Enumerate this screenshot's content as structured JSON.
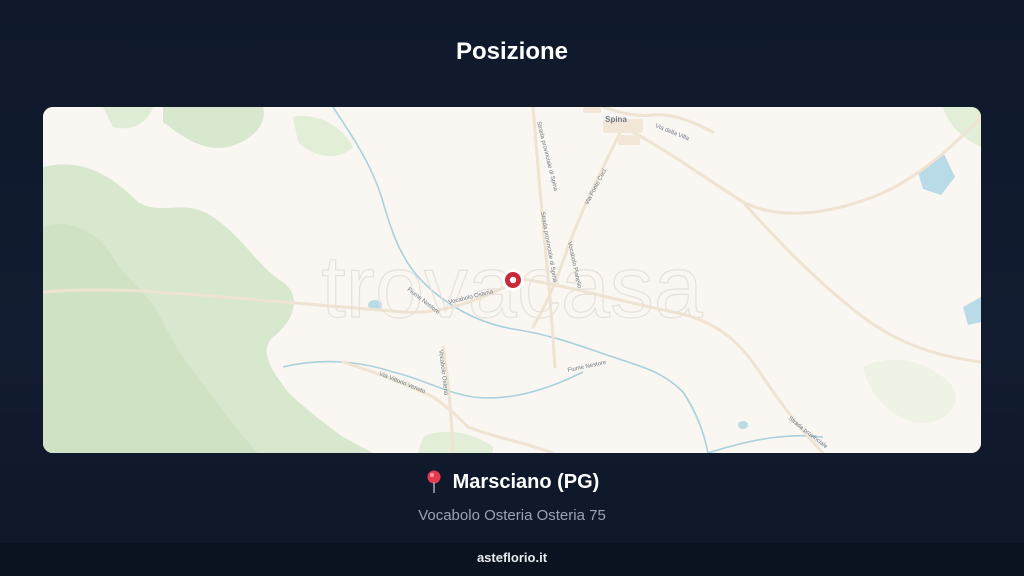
{
  "header": {
    "title": "Posizione"
  },
  "map": {
    "watermark": "trovacasa",
    "labels": {
      "spina": "Spina",
      "via_della_villa": "Via della Villa",
      "strada_provinciale_1": "Strada provinciale di Spina",
      "strada_provinciale_2": "Strada provinciale di Spina",
      "via_fonte_ceci": "Via Fonte Ceci",
      "vocabolo_osteria_1": "Vocabolo Osteria",
      "vocabolo_osteria_2": "Vocabolo Osteria",
      "vocabolo_pianello": "Vocabolo Pianello",
      "fiume_nestore_1": "Fiume Nestore",
      "fiume_nestore_2": "Fiume Nestore",
      "via_vittorio_veneto": "Via Vittorio Veneto",
      "strada_provinciale_3": "Strada provinciale"
    },
    "marker_icon": "location-marker-icon",
    "colors": {
      "land": "#faf6f1",
      "forest": "#d8e8cf",
      "forest_dark": "#cfe3c4",
      "water": "#b9dbe7",
      "river": "#9fcbd9",
      "road": "#f0e6d8",
      "marker": "#c8283a"
    }
  },
  "location": {
    "pin_icon": "red-pushpin-icon",
    "city": "Marsciano (PG)",
    "address": "Vocabolo Osteria Osteria 75"
  },
  "footer": {
    "site": "asteflorio.it"
  }
}
